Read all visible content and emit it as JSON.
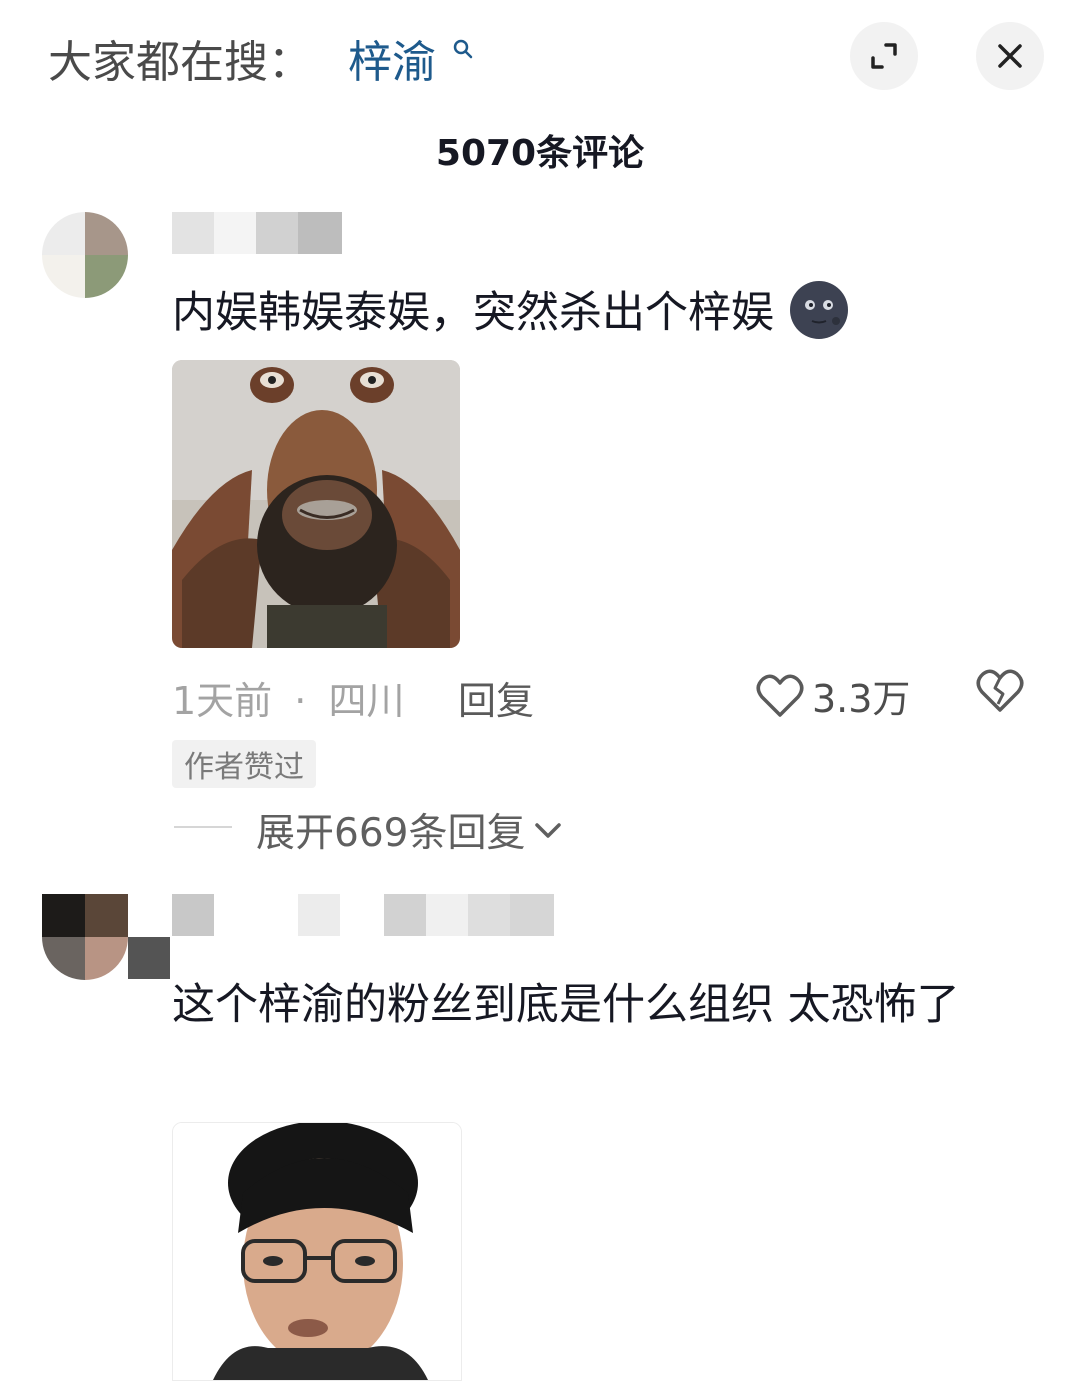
{
  "header": {
    "search_prefix": "大家都在搜：",
    "search_term": "梓渝",
    "search_icon": "search-icon",
    "expand_icon": "expand-icon",
    "close_icon": "close-icon"
  },
  "comments_title": "5070条评论",
  "comments": [
    {
      "text": "内娱韩娱泰娱，突然杀出个梓娱",
      "emoji_icon": "new-moon-face-emoji",
      "image_alt": "meme-photo",
      "time": "1天前",
      "separator": "·",
      "location": "四川",
      "reply_label": "回复",
      "likes": "3.3万",
      "like_icon": "heart-outline-icon",
      "dislike_icon": "broken-heart-icon",
      "badge": "作者赞过",
      "expand_label": "展开669条回复",
      "expand_icon": "chevron-down-icon"
    },
    {
      "text": "这个梓渝的粉丝到底是什么组织 太恐怖了",
      "image_alt": "meme-photo"
    }
  ],
  "colors": {
    "accent_search": "#1e5a8c",
    "muted": "#a3a3a3"
  }
}
